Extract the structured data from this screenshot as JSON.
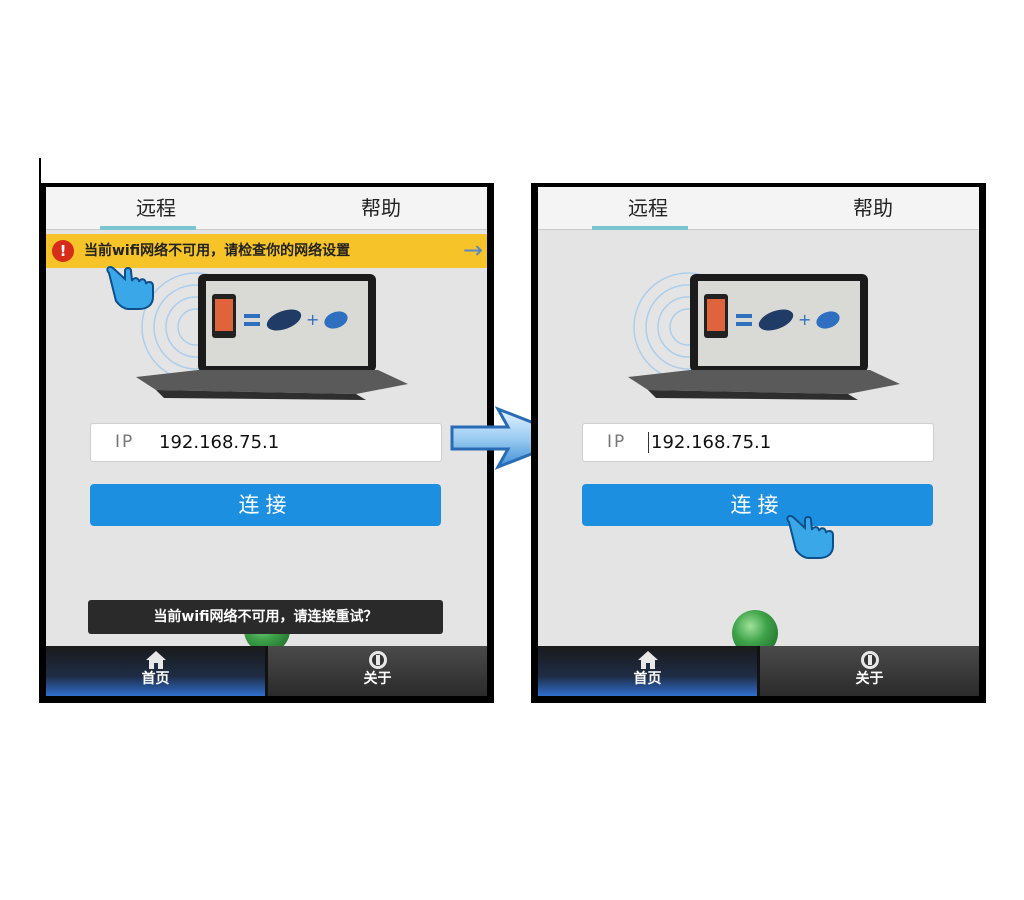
{
  "left_phone": {
    "tabs": [
      "远程",
      "帮助"
    ],
    "warning": {
      "icon": "exclamation-icon",
      "text": "当前wifi网络不可用，请检查你的网络设置",
      "arrow": "→"
    },
    "ip_label": "IP",
    "ip_value": "192.168.75.1",
    "connect_label": "连接",
    "toast": "当前wifi网络不可用，请连接重试？",
    "bottom_nav": [
      {
        "label": "首页",
        "icon": "home-icon"
      },
      {
        "label": "关于",
        "icon": "info-icon"
      }
    ]
  },
  "right_phone": {
    "tabs": [
      "远程",
      "帮助"
    ],
    "ip_label": "IP",
    "ip_value": "192.168.75.1",
    "connect_label": "连接",
    "bottom_nav": [
      {
        "label": "首页",
        "icon": "home-icon"
      },
      {
        "label": "关于",
        "icon": "info-icon"
      }
    ]
  },
  "colors": {
    "accent_blue": "#1d8fe0",
    "warning_yellow": "#f6c428",
    "warning_red": "#d62c1a",
    "tab_indicator": "#7cc4cf"
  }
}
